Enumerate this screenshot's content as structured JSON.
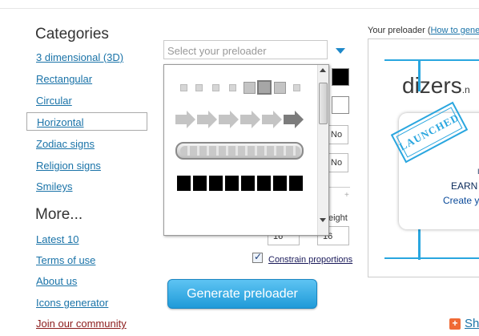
{
  "sidebar": {
    "categories_title": "Categories",
    "categories": [
      {
        "label": "3 dimensional (3D)"
      },
      {
        "label": "Rectangular"
      },
      {
        "label": "Circular"
      },
      {
        "label": "Horizontal",
        "selected": true
      },
      {
        "label": "Zodiac signs"
      },
      {
        "label": "Religion signs"
      },
      {
        "label": "Smileys"
      }
    ],
    "more_title": "More...",
    "more_links": [
      {
        "label": "Latest 10"
      },
      {
        "label": "Terms of use"
      },
      {
        "label": "About us"
      },
      {
        "label": "Icons generator"
      },
      {
        "label": "Join our community"
      }
    ]
  },
  "form": {
    "select_placeholder": "Select your preloader",
    "options": {
      "foreground_color": "#000000",
      "background_color": "#ffffff",
      "option1_value": "No",
      "option2_value": "No",
      "height_label": "eight",
      "width_value": "16",
      "height_value": "16"
    },
    "constrain_label": "Constrain proportions",
    "constrain_checked": true,
    "generate_button": "Generate preloader"
  },
  "dropdown_previews": [
    {
      "name": "squares"
    },
    {
      "name": "arrows"
    },
    {
      "name": "progress-bar"
    },
    {
      "name": "black-blocks"
    }
  ],
  "preview": {
    "label_prefix": "Your preloader (",
    "label_link": "How to gene",
    "brand_text": "dizers",
    "brand_suffix": ".n",
    "stamp_text": "LAUNCHED",
    "earn_text": "EARN",
    "create_text": "Create y",
    "dot_text": "I"
  },
  "footer": {
    "share_icon": "plus-icon",
    "share_text": "Sh"
  },
  "colors": {
    "accent": "#29a6df",
    "link": "#1a73a8",
    "button_top": "#5ec4f3",
    "button_bottom": "#1f9ad8",
    "share": "#f06a35"
  }
}
